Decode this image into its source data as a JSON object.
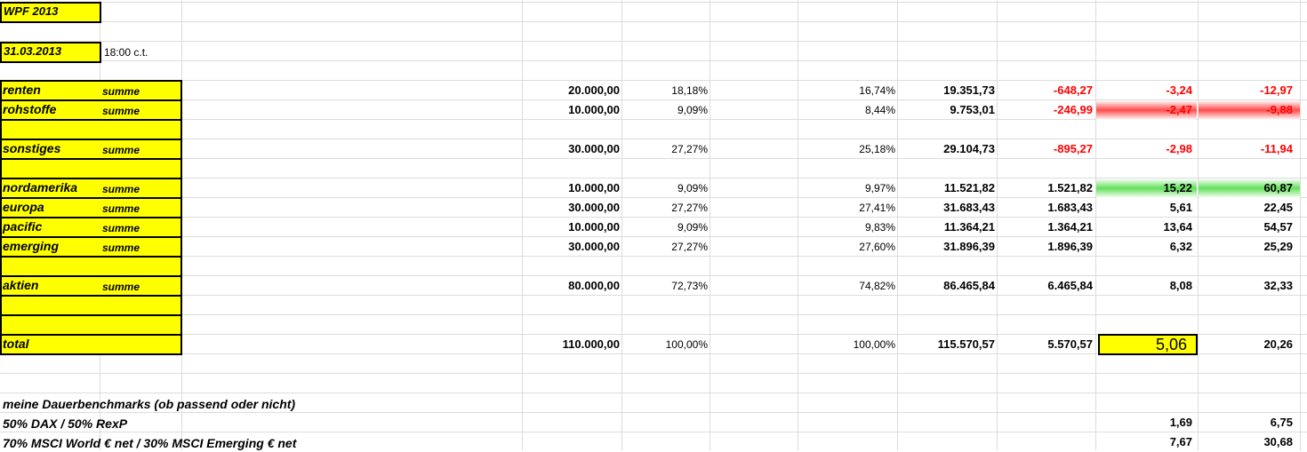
{
  "header": {
    "title": "WPF 2013",
    "date": "31.03.2013",
    "time": "18:00 c.t."
  },
  "rows": [
    {
      "label": "renten",
      "sum": "summe",
      "v1": "20.000,00",
      "v2": "18,18%",
      "v3": "16,74%",
      "v4": "19.351,73",
      "v5": "-648,27",
      "v6": "-3,24",
      "v7": "-12,97"
    },
    {
      "label": "rohstoffe",
      "sum": "summe",
      "v1": "10.000,00",
      "v2": "9,09%",
      "v3": "8,44%",
      "v4": "9.753,01",
      "v5": "-246,99",
      "v6": "-2,47",
      "v7": "-9,88"
    },
    {
      "label": "sonstiges",
      "sum": "summe",
      "v1": "30.000,00",
      "v2": "27,27%",
      "v3": "25,18%",
      "v4": "29.104,73",
      "v5": "-895,27",
      "v6": "-2,98",
      "v7": "-11,94"
    },
    {
      "label": "nordamerika",
      "sum": "summe",
      "v1": "10.000,00",
      "v2": "9,09%",
      "v3": "9,97%",
      "v4": "11.521,82",
      "v5": "1.521,82",
      "v6": "15,22",
      "v7": "60,87"
    },
    {
      "label": "europa",
      "sum": "summe",
      "v1": "30.000,00",
      "v2": "27,27%",
      "v3": "27,41%",
      "v4": "31.683,43",
      "v5": "1.683,43",
      "v6": "5,61",
      "v7": "22,45"
    },
    {
      "label": "pacific",
      "sum": "summe",
      "v1": "10.000,00",
      "v2": "9,09%",
      "v3": "9,83%",
      "v4": "11.364,21",
      "v5": "1.364,21",
      "v6": "13,64",
      "v7": "54,57"
    },
    {
      "label": "emerging",
      "sum": "summe",
      "v1": "30.000,00",
      "v2": "27,27%",
      "v3": "27,60%",
      "v4": "31.896,39",
      "v5": "1.896,39",
      "v6": "6,32",
      "v7": "25,29"
    },
    {
      "label": "aktien",
      "sum": "summe",
      "v1": "80.000,00",
      "v2": "72,73%",
      "v3": "74,82%",
      "v4": "86.465,84",
      "v5": "6.465,84",
      "v6": "8,08",
      "v7": "32,33"
    },
    {
      "label": "total",
      "v1": "110.000,00",
      "v2": "100,00%",
      "v3": "100,00%",
      "v4": "115.570,57",
      "v5": "5.570,57",
      "v6": "5,06",
      "v7": "20,26"
    }
  ],
  "benchmarks": {
    "heading": "meine Dauerbenchmarks (ob passend oder nicht)",
    "items": [
      {
        "label": "50% DAX / 50% RexP",
        "v6": "1,69",
        "v7": "6,75"
      },
      {
        "label": "70% MSCI World € net / 30% MSCI Emerging € net",
        "v6": "7,67",
        "v7": "30,68"
      }
    ]
  },
  "colors": {
    "highlight": "#ffff00",
    "negative": "#ff0000",
    "gridline": "#dadcdd"
  }
}
